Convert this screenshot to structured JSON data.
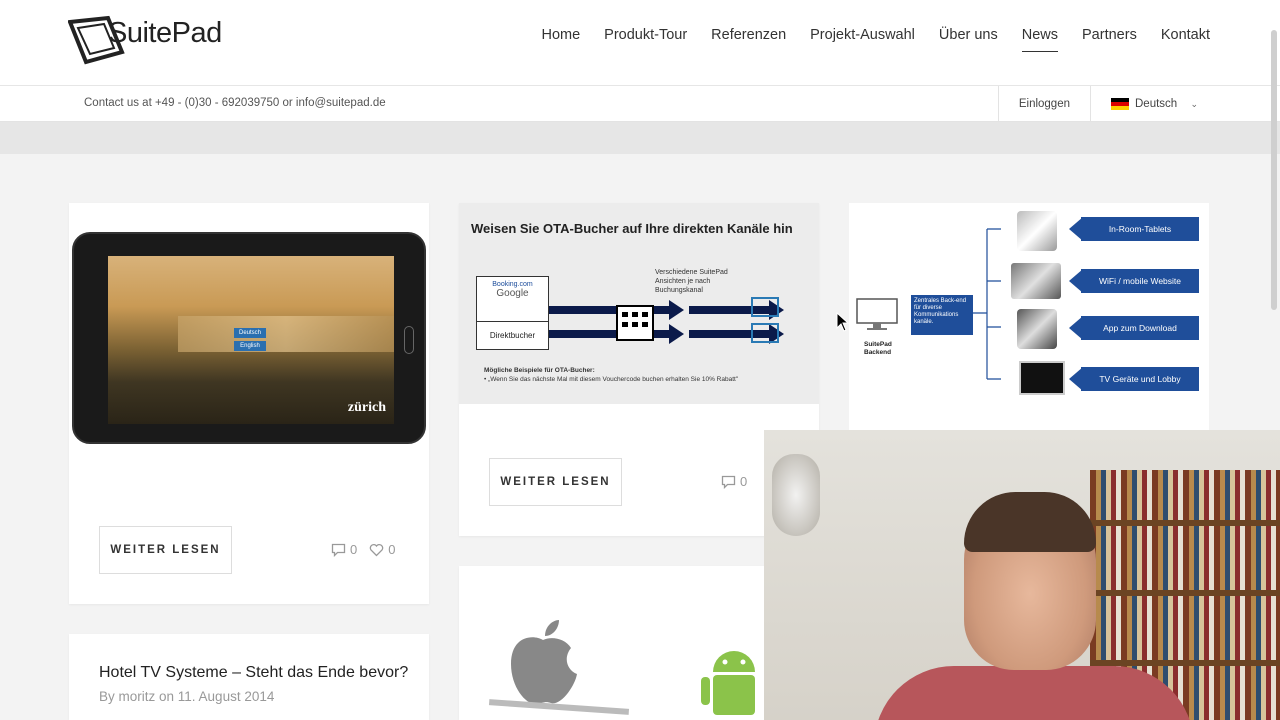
{
  "brand": {
    "name": "SuitePad"
  },
  "nav": {
    "items": [
      {
        "label": "Home"
      },
      {
        "label": "Produkt-Tour"
      },
      {
        "label": "Referenzen"
      },
      {
        "label": "Projekt-Auswahl"
      },
      {
        "label": "Über uns"
      },
      {
        "label": "News"
      },
      {
        "label": "Partners"
      },
      {
        "label": "Kontakt"
      }
    ],
    "active": "News"
  },
  "topbar": {
    "contact": "Contact us at +49 - (0)30 - 692039750 or info@suitepad.de",
    "login": "Einloggen",
    "language": "Deutsch"
  },
  "cards": {
    "card1": {
      "image": {
        "lang1": "Deutsch",
        "lang2": "English",
        "city": "zürich"
      },
      "more_label": "WEITER LESEN",
      "comments": "0",
      "likes": "0"
    },
    "card2": {
      "image": {
        "title": "Weisen Sie OTA-Bucher auf Ihre direkten Kanäle hin",
        "ota_brands": "Booking.com",
        "ota_google": "Google",
        "direct": "Direktbucher",
        "caption1": "Verschiedene SuitePad",
        "caption2": "Ansichten je nach",
        "caption3": "Buchungskanal",
        "note_title": "Mögliche Beispiele für OTA-Bucher:",
        "note_text": "• „Wenn Sie das nächste Mal mit diesem Vouchercode buchen erhalten Sie 10% Rabatt\""
      },
      "more_label": "WEITER LESEN",
      "comments": "0"
    },
    "card3": {
      "image": {
        "backend_box": "Zentrales Back-end für diverse Kommunikations kanäle.",
        "backend_label1": "SuitePad",
        "backend_label2": "Backend",
        "labels": [
          "In-Room-Tablets",
          "WiFi / mobile Website",
          "App zum Download",
          "TV Geräte und Lobby"
        ]
      }
    },
    "card5": {
      "title": "Hotel TV Systeme – Steht das Ende bevor?",
      "meta": "By moritz on 11. August 2014"
    }
  },
  "colors": {
    "accent_blue": "#1f4e9a",
    "page_bg": "#f3f3f3"
  }
}
